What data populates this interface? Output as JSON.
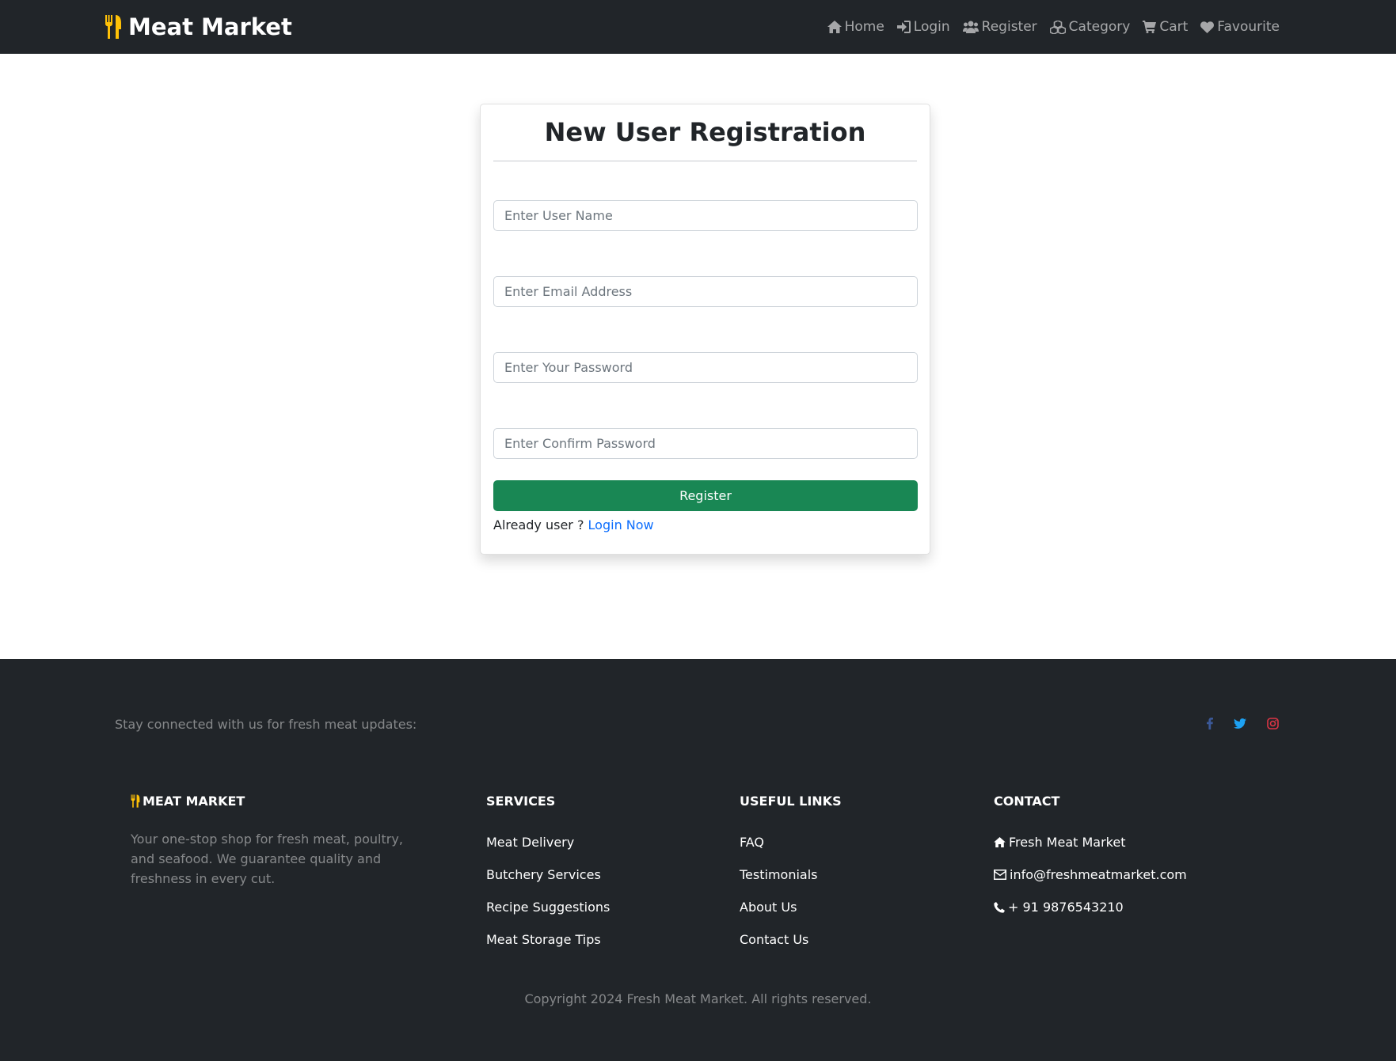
{
  "navbar": {
    "brand": "Meat Market",
    "links": [
      {
        "label": "Home",
        "icon": "home-icon"
      },
      {
        "label": "Login",
        "icon": "sign-in-icon"
      },
      {
        "label": "Register",
        "icon": "users-icon"
      },
      {
        "label": "Category",
        "icon": "cubes-icon"
      },
      {
        "label": "Cart",
        "icon": "cart-icon"
      },
      {
        "label": "Favourite",
        "icon": "heart-icon"
      }
    ]
  },
  "form": {
    "title": "New User Registration",
    "username_placeholder": "Enter User Name",
    "email_placeholder": "Enter Email Address",
    "password_placeholder": "Enter Your Password",
    "confirm_placeholder": "Enter Confirm Password",
    "submit_label": "Register",
    "already_text": "Already user ?",
    "login_link": "Login Now"
  },
  "footer": {
    "stay_connected": "Stay connected with us for fresh meat updates:",
    "social_colors": {
      "facebook": "#3b5998",
      "twitter": "#1da1f2",
      "instagram": "#dc3545"
    },
    "brand_title": "MEAT MARKET",
    "about": "Your one-stop shop for fresh meat, poultry, and seafood. We guarantee quality and freshness in every cut.",
    "services": {
      "title": "SERVICES",
      "items": [
        "Meat Delivery",
        "Butchery Services",
        "Recipe Suggestions",
        "Meat Storage Tips"
      ]
    },
    "useful_links": {
      "title": "USEFUL LINKS",
      "items": [
        "FAQ",
        "Testimonials",
        "About Us",
        "Contact Us"
      ]
    },
    "contact": {
      "title": "CONTACT",
      "address": "Fresh Meat Market",
      "email": "info@freshmeatmarket.com",
      "phone": "+ 91 9876543210"
    },
    "copyright": "Copyright 2024 Fresh Meat Market. All rights reserved."
  },
  "colors": {
    "accent": "#198754",
    "brand_icon": "#ffc107",
    "dark": "#212529",
    "link": "#0d6efd"
  }
}
